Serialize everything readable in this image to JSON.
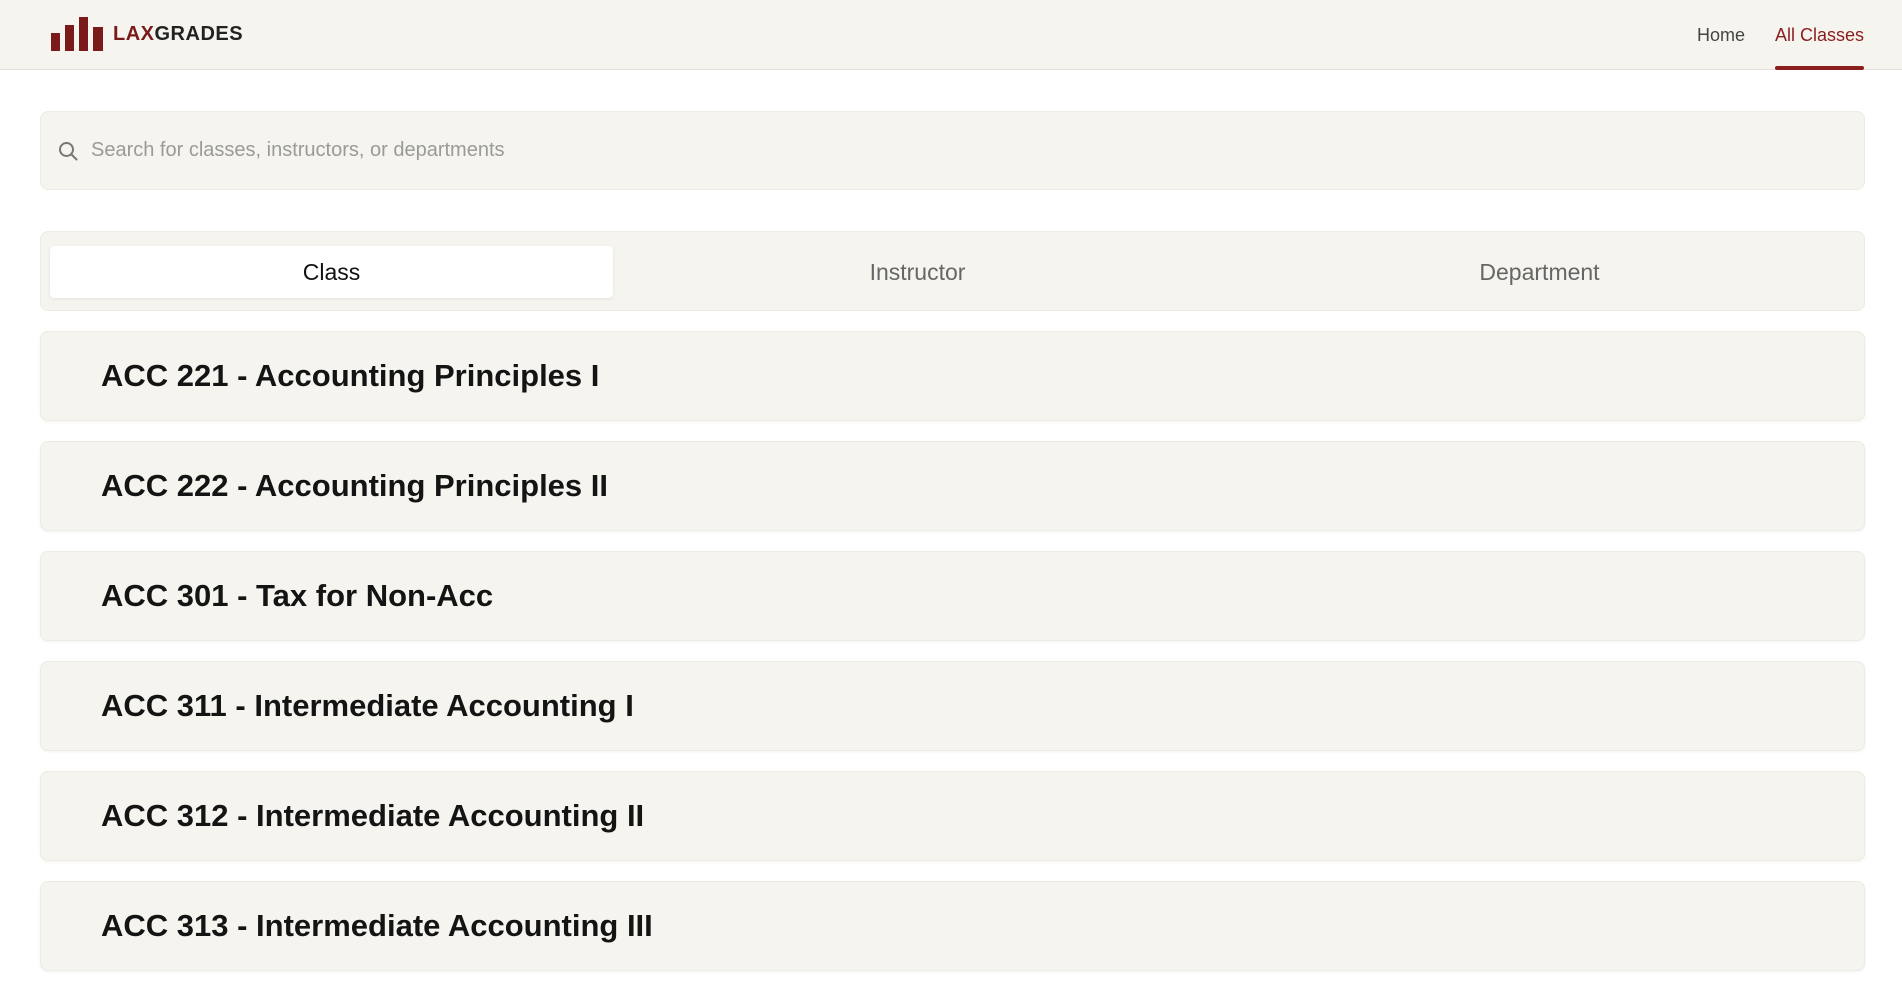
{
  "brand": {
    "name_part1": "LAX",
    "name_part2": "GRADES",
    "icon": "bar-chart-icon",
    "primary_color": "#8b1e1e"
  },
  "nav": {
    "items": [
      {
        "label": "Home",
        "active": false
      },
      {
        "label": "All Classes",
        "active": true
      }
    ]
  },
  "search": {
    "placeholder": "Search for classes, instructors, or departments",
    "value": "",
    "icon": "search-icon"
  },
  "tabs": [
    {
      "label": "Class",
      "active": true
    },
    {
      "label": "Instructor",
      "active": false
    },
    {
      "label": "Department",
      "active": false
    }
  ],
  "classes": [
    {
      "label": "ACC 221 - Accounting Principles I"
    },
    {
      "label": "ACC 222 - Accounting Principles II"
    },
    {
      "label": "ACC 301 - Tax for Non-Acc"
    },
    {
      "label": "ACC 311 - Intermediate Accounting I"
    },
    {
      "label": "ACC 312 - Intermediate Accounting II"
    },
    {
      "label": "ACC 313 - Intermediate Accounting III"
    }
  ]
}
